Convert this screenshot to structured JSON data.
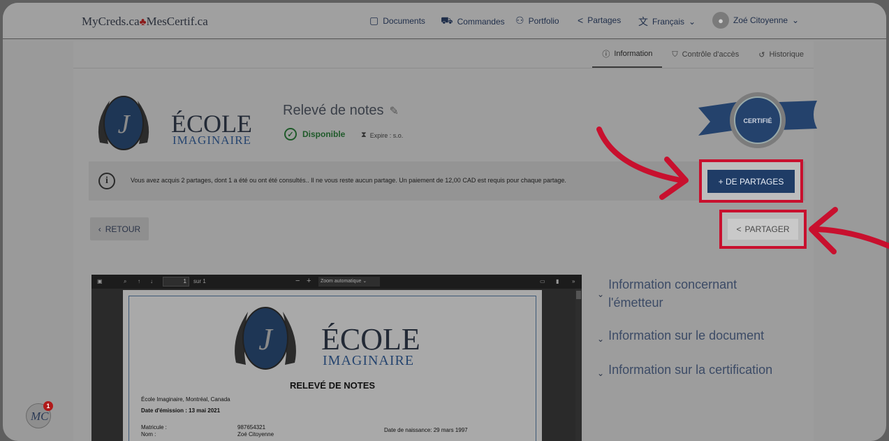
{
  "header": {
    "brand": "MyCreds.ca",
    "brand_leaf": "♣",
    "brand_fr": "MesCertif.ca",
    "nav": [
      {
        "label": "Documents",
        "icon": "document-icon"
      },
      {
        "label": "Commandes",
        "icon": "cart-icon"
      },
      {
        "label": "Portfolio",
        "icon": "people-icon"
      },
      {
        "label": "Partages",
        "icon": "share-icon"
      },
      {
        "label": "Français",
        "icon": "language-icon"
      }
    ],
    "user": "Zoé Citoyenne"
  },
  "tabs": [
    {
      "label": "Information",
      "active": true
    },
    {
      "label": "Contrôle d'accès",
      "active": false
    },
    {
      "label": "Historique",
      "active": false
    }
  ],
  "institution": {
    "name_top": "ÉCOLE",
    "name_bottom": "IMAGINAIRE"
  },
  "document": {
    "title": "Relevé de notes",
    "status": "Disponible",
    "expire": "Expire : s.o.",
    "certified_badge": "CERTIFIÉ"
  },
  "info_message": "Vous avez acquis 2 partages, dont 1 a été ou ont été consultés.. Il ne vous reste aucun partage. Un paiement de 12,00 CAD est requis pour chaque partage.",
  "buttons": {
    "more_shares": "+ DE PARTAGES",
    "back": "RETOUR",
    "share": "PARTAGER"
  },
  "pdf_viewer": {
    "page_value": "1",
    "page_of": "sur 1",
    "zoom": "Zoom automatique",
    "content": {
      "heading": "RELEVÉ DE NOTES",
      "location": "École Imaginaire, Montréal, Canada",
      "issue_date": "Date d'émission : 13 mai 2021",
      "matricule_label": "Matricule :",
      "matricule_value": "987654321",
      "nom_label": "Nom :",
      "nom_value": "Zoé Citoyenne",
      "birth": "Date de naissance: 29 mars 1997"
    }
  },
  "accordion": [
    {
      "line1": "Information concernant",
      "line2": "l'émetteur"
    },
    {
      "line1": "Information sur le document"
    },
    {
      "line1": "Information sur la certification"
    }
  ],
  "widget": {
    "label": "MC",
    "count": "1"
  },
  "colors": {
    "primary": "#1f3c66",
    "highlight": "#c8102e",
    "status_ok": "#1f5a2a"
  }
}
